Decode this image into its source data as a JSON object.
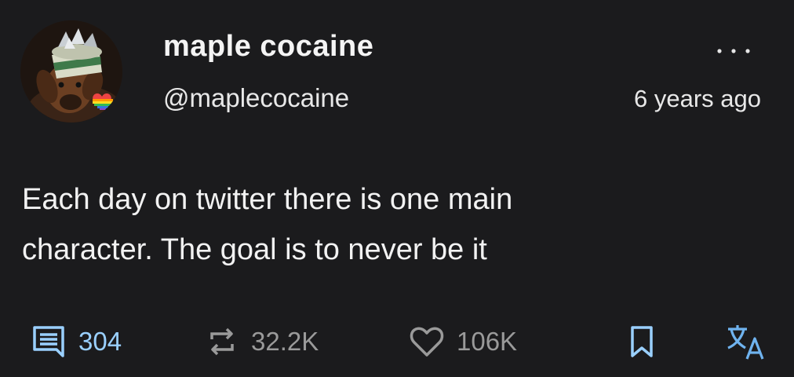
{
  "author": {
    "display_name": "maple cocaine",
    "handle": "@maplecocaine"
  },
  "timestamp": "6 years ago",
  "tweet": {
    "text": "Each day on twitter there is one main\ncharacter. The goal is to never be it"
  },
  "actions": {
    "replies": "304",
    "retweets": "32.2K",
    "likes": "106K"
  },
  "icons": {
    "more": "more-dots-icon",
    "reply": "comment-icon",
    "retweet": "retweet-icon",
    "like": "heart-icon",
    "bookmark": "bookmark-icon",
    "translate": "translate-icon"
  },
  "colors": {
    "background": "#1b1b1d",
    "accent": "#9ad0ff",
    "muted": "#9a9a9a"
  }
}
